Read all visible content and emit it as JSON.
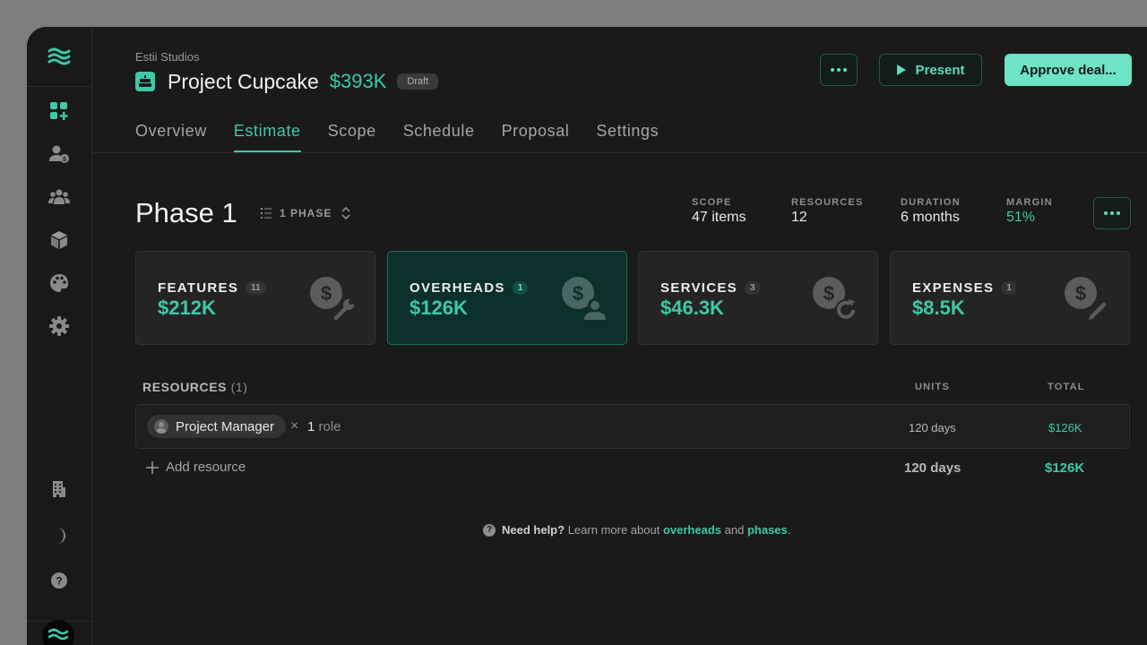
{
  "header": {
    "org": "Estii Studios",
    "project_title": "Project Cupcake",
    "project_value": "$393K",
    "status_badge": "Draft",
    "present_label": "Present",
    "approve_label": "Approve deal..."
  },
  "tabs": [
    {
      "label": "Overview",
      "active": false
    },
    {
      "label": "Estimate",
      "active": true
    },
    {
      "label": "Scope",
      "active": false
    },
    {
      "label": "Schedule",
      "active": false
    },
    {
      "label": "Proposal",
      "active": false
    },
    {
      "label": "Settings",
      "active": false
    }
  ],
  "sidebar": {
    "items": [
      {
        "icon": "dashboard-add-icon",
        "active": true
      },
      {
        "icon": "user-dollar-icon"
      },
      {
        "icon": "team-icon"
      },
      {
        "icon": "cube-icon"
      },
      {
        "icon": "palette-icon"
      },
      {
        "icon": "gear-icon"
      },
      {
        "icon": "building-icon"
      },
      {
        "icon": "moon-icon"
      },
      {
        "icon": "help-icon"
      }
    ]
  },
  "phase": {
    "title": "Phase 1",
    "selector_label": "1 PHASE"
  },
  "stats": {
    "scope_label": "SCOPE",
    "scope_value": "47 items",
    "resources_label": "RESOURCES",
    "resources_value": "12",
    "duration_label": "DURATION",
    "duration_value": "6 months",
    "margin_label": "MARGIN",
    "margin_value": "51%"
  },
  "cards": [
    {
      "label": "FEATURES",
      "count": "11",
      "value": "$212K",
      "icon": "dollar-wrench-icon",
      "active": false
    },
    {
      "label": "OVERHEADS",
      "count": "1",
      "value": "$126K",
      "icon": "dollar-person-icon",
      "active": true
    },
    {
      "label": "SERVICES",
      "count": "3",
      "value": "$46.3K",
      "icon": "dollar-refresh-icon",
      "active": false
    },
    {
      "label": "EXPENSES",
      "count": "1",
      "value": "$8.5K",
      "icon": "dollar-pencil-icon",
      "active": false
    }
  ],
  "resources": {
    "title": "RESOURCES",
    "count": "(1)",
    "col_units": "UNITS",
    "col_total": "TOTAL",
    "rows": [
      {
        "name": "Project Manager",
        "role_count": "1",
        "role_word": "role",
        "units": "120 days",
        "total": "$126K"
      }
    ],
    "add_label": "Add resource",
    "sum_units": "120 days",
    "sum_total": "$126K"
  },
  "help": {
    "lead": "Need help?",
    "text": "Learn more about",
    "link1": "overheads",
    "and": "and",
    "link2": "phases",
    "end": "."
  },
  "colors": {
    "accent": "#3ec9a7",
    "background": "#1a1a1a",
    "approve_bg": "#6ee3c6"
  }
}
